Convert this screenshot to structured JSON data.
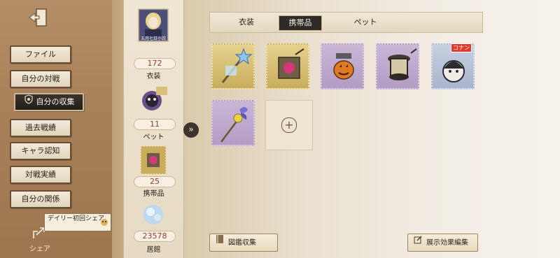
{
  "menu": {
    "items": [
      {
        "label": "ファイル",
        "active": false
      },
      {
        "label": "自分の対戦",
        "active": false
      },
      {
        "label": "自分の収集",
        "active": true
      },
      {
        "label": "過去戦績",
        "active": false
      },
      {
        "label": "キャラ認知",
        "active": false
      },
      {
        "label": "対戦実績",
        "active": false
      },
      {
        "label": "自分の関係",
        "active": false
      }
    ],
    "daily_share": "デイリー初回シェア",
    "share_label": "シェア"
  },
  "stats": {
    "costume": {
      "count": "172",
      "label": "衣装",
      "card_caption": "五月七日小説"
    },
    "pet": {
      "count": "11",
      "label": "ペット"
    },
    "accessory": {
      "count": "25",
      "label": "携帯品"
    },
    "museum": {
      "count": "23578",
      "label": "居館"
    }
  },
  "tabs": [
    {
      "label": "衣装",
      "active": false
    },
    {
      "label": "携帯品",
      "active": true
    },
    {
      "label": "ペット",
      "active": false
    }
  ],
  "items": [
    {
      "name": "star-staff-item",
      "rarity": "gold",
      "badge": ""
    },
    {
      "name": "gem-lantern-item",
      "rarity": "gold",
      "badge": ""
    },
    {
      "name": "pumpkin-lantern-item",
      "rarity": "purple",
      "badge": ""
    },
    {
      "name": "dark-lantern-item",
      "rarity": "purple",
      "badge": ""
    },
    {
      "name": "character-pendant-item",
      "rarity": "purple",
      "badge": "コナン"
    },
    {
      "name": "butterfly-wand-item",
      "rarity": "purple",
      "badge": ""
    }
  ],
  "buttons": {
    "collection": "図鑑収集",
    "edit_display": "展示効果編集"
  },
  "colors": {
    "accent_dark": "#2f2a25",
    "count_red": "#9a3a2e",
    "rarity_gold": "#c9ad5d",
    "rarity_purple": "#b39cc5"
  }
}
